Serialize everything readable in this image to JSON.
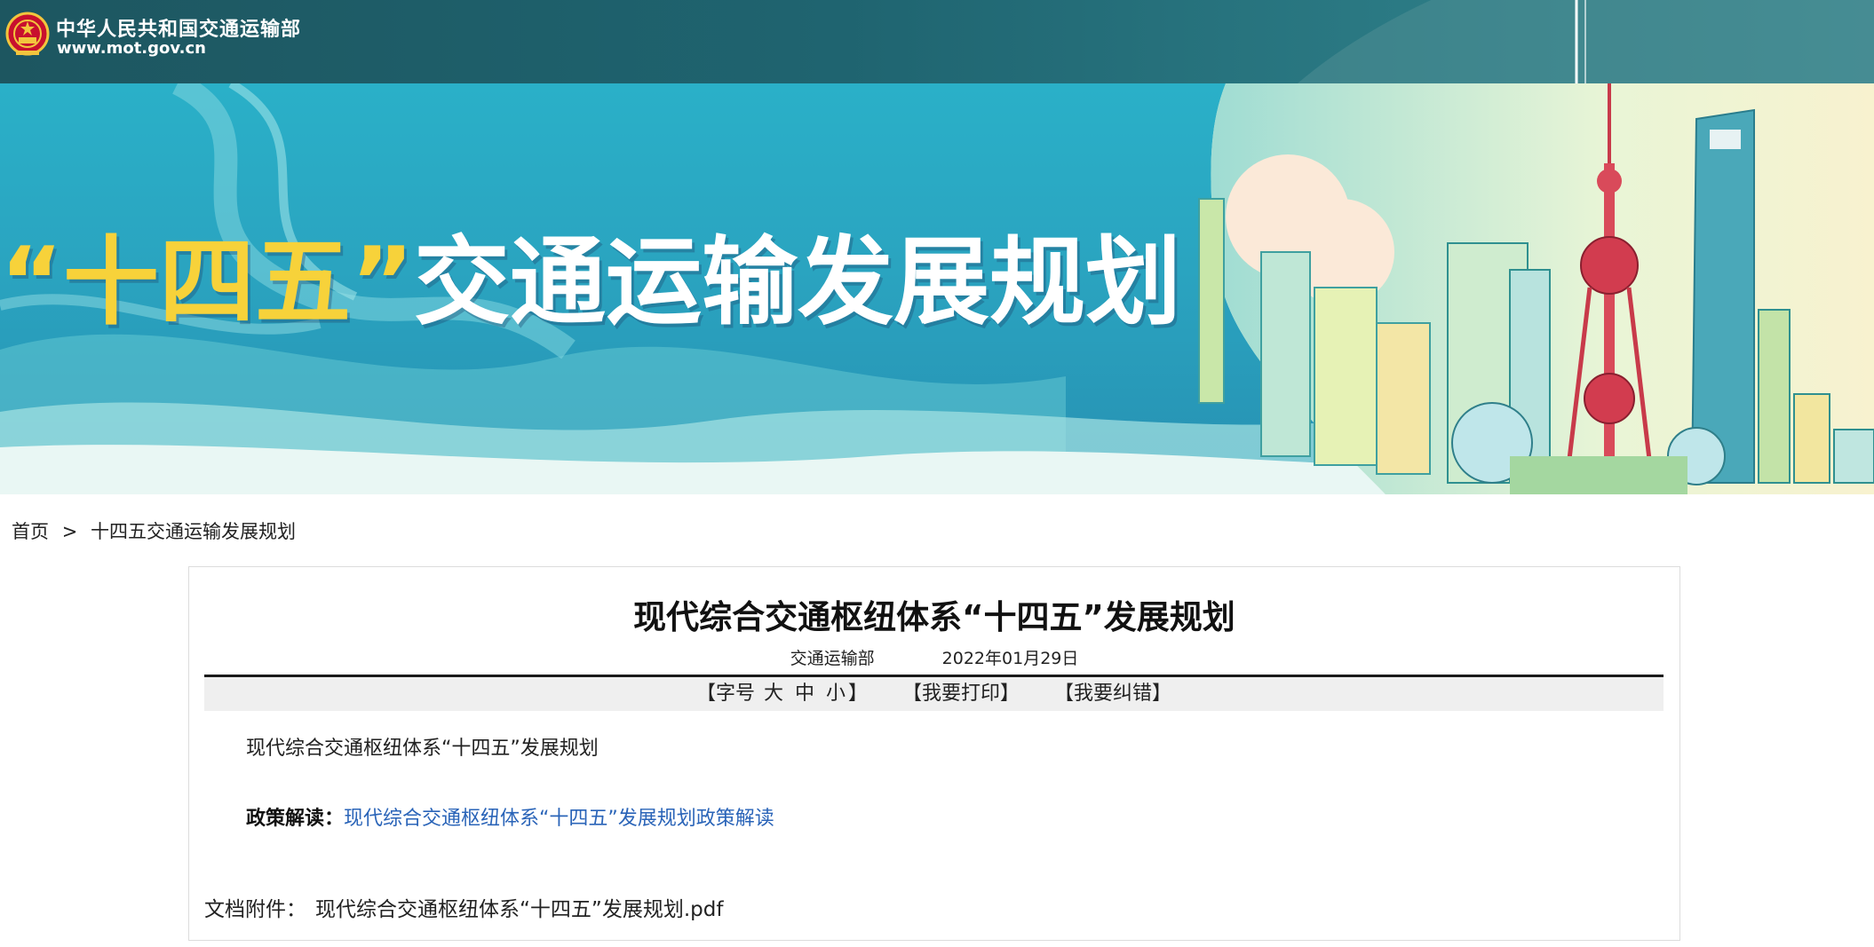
{
  "header": {
    "ministry_name": "中华人民共和国交通运输部",
    "site_url": "www.mot.gov.cn"
  },
  "banner": {
    "title_yellow": "“十四五”",
    "title_white": "交通运输发展规划"
  },
  "breadcrumb": {
    "home": "首页",
    "separator": ">",
    "current": "十四五交通运输发展规划"
  },
  "article": {
    "title": "现代综合交通枢纽体系“十四五”发展规划",
    "source": "交通运输部",
    "date": "2022年01月29日",
    "toolbar": {
      "font_size_open": "【字号",
      "size_large": "大",
      "size_medium": "中",
      "size_small": "小",
      "font_size_close": "】",
      "print": "【我要打印】",
      "correction": "【我要纠错】"
    },
    "body_text": "现代综合交通枢纽体系“十四五”发展规划",
    "policy_label": "政策解读：",
    "policy_link": "现代综合交通枢纽体系“十四五”发展规划政策解读",
    "attachment_label": "文档附件：",
    "attachment_link": "现代综合交通枢纽体系“十四五”发展规划.pdf"
  },
  "colors": {
    "header_bg": "#1f6470",
    "banner_bg": "#2aa4c0",
    "banner_title_highlight": "#f7d23a",
    "link": "#2a64b8",
    "toolbar_bg": "#efefef"
  },
  "icons": {
    "emblem": "national-emblem-icon"
  }
}
